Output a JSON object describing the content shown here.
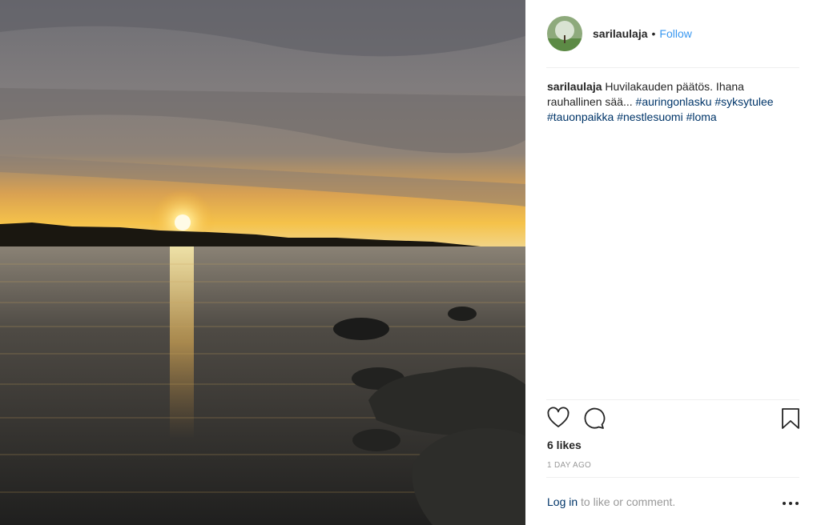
{
  "post": {
    "username": "sarilaulaja",
    "separator": "•",
    "follow_label": "Follow",
    "caption": {
      "username": "sarilaulaja",
      "text": "Huvilakauden päätös. Ihana rauhallinen sää...",
      "hashtags": [
        "#auringonlasku",
        "#syksytulee",
        "#tauonpaikka",
        "#nestlesuomi",
        "#loma"
      ]
    },
    "likes": "6 likes",
    "time": "1 DAY AGO",
    "footer": {
      "login_label": "Log in",
      "rest_text": "to like or comment."
    }
  },
  "icons": {
    "like": "heart-icon",
    "comment": "comment-icon",
    "save": "bookmark-icon",
    "more": "more-options-icon"
  },
  "colors": {
    "follow": "#3897f0",
    "hashtag": "#003569",
    "muted": "#999999",
    "text": "#262626"
  }
}
